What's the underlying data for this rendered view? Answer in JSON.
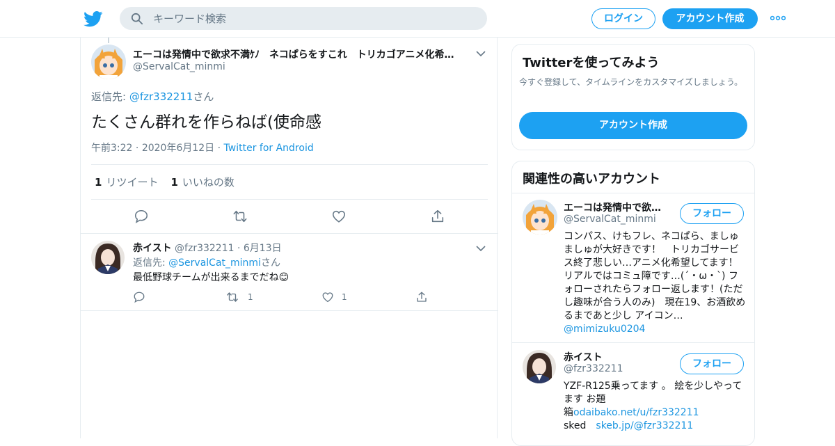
{
  "header": {
    "search_placeholder": "キーワード検索",
    "login_label": "ログイン",
    "signup_label": "アカウント作成"
  },
  "tweet": {
    "author_name": "エーコは発情中で欲求不満ｹﾉ　ネコぱらをすこれ　トリカゴアニメ化希…",
    "author_handle": "@ServalCat_minmi",
    "reply_to_prefix": "返信先: ",
    "reply_to_handle": "@fzr332211",
    "reply_to_suffix": "さん",
    "text": "たくさん群れを作らねば(使命感",
    "time": "午前3:22",
    "date": "2020年6月12日",
    "source": "Twitter for Android",
    "retweet_count": "1",
    "retweet_label": "リツイート",
    "like_count": "1",
    "like_label": "いいねの数"
  },
  "reply": {
    "author_name": "赤イスト",
    "author_handle": "@fzr332211",
    "date": "6月13日",
    "reply_to_prefix": "返信先: ",
    "reply_to_handle": "@ServalCat_minmi",
    "reply_to_suffix": "さん",
    "text": "最低野球チームが出来るまでだね😊",
    "retweet_count": "1",
    "like_count": "1"
  },
  "try_card": {
    "title": "Twitterを使ってみよう",
    "description": "今すぐ登録して、タイムラインをカスタマイズしましょう。",
    "button_label": "アカウント作成"
  },
  "related": {
    "title": "関連性の高いアカウント",
    "follow_label": "フォロー",
    "accounts": [
      {
        "name": "エーコは発情中で欲…",
        "handle": "@ServalCat_minmi",
        "bio": "コンパス、けもフレ、ネコぱら、ましゅましゅが大好きです！　トリカゴサービス終了悲しい…アニメ化希望してます！　リアルではコミュ障です…(´・ω・`) フォローされたらフォロー返します！(ただし趣味が合う人のみ)　現在19、お酒飲めるまであと少し アイコン…",
        "bio_link": "@mimizuku0204"
      },
      {
        "name": "赤イスト",
        "handle": "@fzr332211",
        "bio_line1": "YZF-R125乗ってます 。 絵を少しやってます お題",
        "bio_line2_prefix": "箱",
        "bio_link1": "odaibako.net/u/fzr332211",
        "bio_line3_prefix": "sked　",
        "bio_link2": "skeb.jp/@fzr332211"
      }
    ]
  },
  "colors": {
    "accent": "#1da1f2",
    "link": "#1b95e0",
    "muted": "#657786",
    "border": "#e6ecf0"
  }
}
